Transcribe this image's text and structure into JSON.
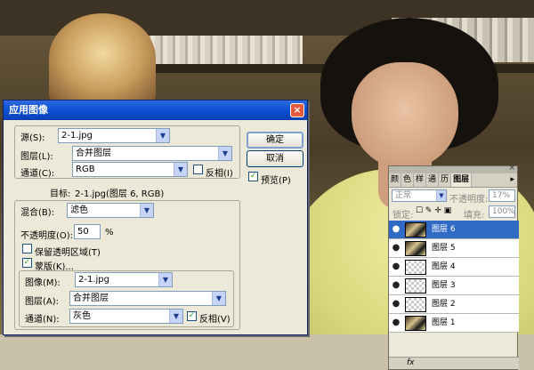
{
  "dialog": {
    "title": "应用图像",
    "close_glyph": "×",
    "source_label": "源(S):",
    "source_value": "2-1.jpg",
    "layer_label": "图层(L):",
    "layer_value": "合并图层",
    "channel_label": "通道(C):",
    "channel_value": "RGB",
    "invert_label": "反相(I)",
    "target_label": "目标:",
    "target_value": "2-1.jpg(图层 6, RGB)",
    "blending_label": "混合(B):",
    "blending_value": "滤色",
    "opacity_label": "不透明度(O):",
    "opacity_value": "50",
    "opacity_unit": "%",
    "preserve_label": "保留透明区域(T)",
    "mask_label": "蒙版(K)...",
    "mask_image_label": "图像(M):",
    "mask_image_value": "2-1.jpg",
    "mask_layer_label": "图层(A):",
    "mask_layer_value": "合并图层",
    "mask_channel_label": "通道(N):",
    "mask_channel_value": "灰色",
    "mask_invert_label": "反相(V)",
    "ok_label": "确定",
    "cancel_label": "取消",
    "preview_label": "预览(P)",
    "check_glyph": "✓",
    "dropdown_glyph": "▼",
    "invert_checked": false,
    "preserve_checked": false,
    "mask_checked": true,
    "mask_invert_checked": true,
    "preview_checked": true
  },
  "layers_panel": {
    "tabs": [
      "颜",
      "色",
      "样",
      "通",
      "历",
      "图层"
    ],
    "close_glyph": "×",
    "menu_glyph": "▸",
    "blend_mode": "正常",
    "opacity_label": "不透明度:",
    "opacity_value": "17%",
    "lock_label": "锁定:",
    "fill_label": "填充:",
    "fill_value": "100%",
    "eye_glyph": "●",
    "footer_text": "fx",
    "layers": [
      {
        "name": "图层 6",
        "thumb": "photo",
        "selected": true
      },
      {
        "name": "图层 5",
        "thumb": "photo",
        "selected": false
      },
      {
        "name": "图层 4",
        "thumb": "checker",
        "selected": false
      },
      {
        "name": "图层 3",
        "thumb": "checker",
        "selected": false
      },
      {
        "name": "图层 2",
        "thumb": "checker",
        "selected": false
      },
      {
        "name": "图层 1",
        "thumb": "photo",
        "selected": false
      }
    ]
  }
}
